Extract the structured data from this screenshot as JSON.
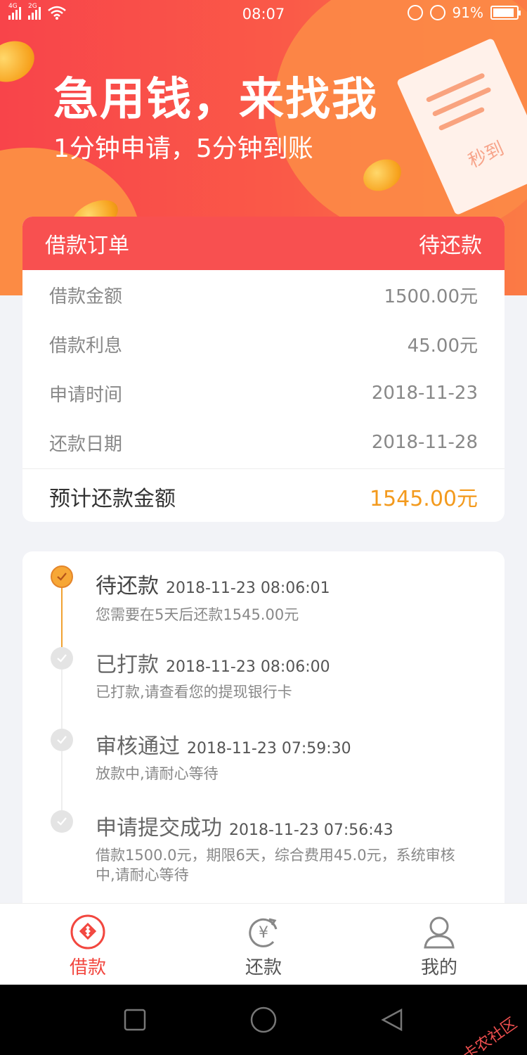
{
  "status_bar": {
    "net1": "4G",
    "net2": "2G",
    "time": "08:07",
    "battery": "91%",
    "battery_level": 0.91
  },
  "hero": {
    "title": "急用钱，来找我",
    "subtitle": "1分钟申请，5分钟到账",
    "stamp": "秒到"
  },
  "order": {
    "header_title": "借款订单",
    "header_status": "待还款",
    "rows": [
      {
        "label": "借款金额",
        "value": "1500.00元"
      },
      {
        "label": "借款利息",
        "value": "45.00元"
      },
      {
        "label": "申请时间",
        "value": "2018-11-23"
      },
      {
        "label": "还款日期",
        "value": "2018-11-28"
      }
    ],
    "total_label": "预计还款金额",
    "total_value": "1545.00元",
    "accent": "#f39a1d",
    "header_color": "#f85050"
  },
  "timeline": [
    {
      "title": "待还款",
      "time": "2018-11-23 08:06:01",
      "desc": "您需要在5天后还款1545.00元",
      "active": true
    },
    {
      "title": "已打款",
      "time": "2018-11-23 08:06:00",
      "desc": "已打款,请查看您的提现银行卡",
      "active": false
    },
    {
      "title": "审核通过",
      "time": "2018-11-23 07:59:30",
      "desc": "放款中,请耐心等待",
      "active": false
    },
    {
      "title": "申请提交成功",
      "time": "2018-11-23 07:56:43",
      "desc": "借款1500.0元，期限6天，综合费用45.0元，系统审核中,请耐心等待",
      "active": false
    }
  ],
  "tabs": [
    {
      "label": "借款",
      "icon": "loan-icon",
      "active": true
    },
    {
      "label": "还款",
      "icon": "repay-yen-icon",
      "active": false
    },
    {
      "label": "我的",
      "icon": "user-icon",
      "active": false
    }
  ],
  "watermark": "卡农社区",
  "colors": {
    "brand_red": "#f2473f",
    "hero_start": "#f8444a",
    "hero_end": "#fb7b45"
  }
}
